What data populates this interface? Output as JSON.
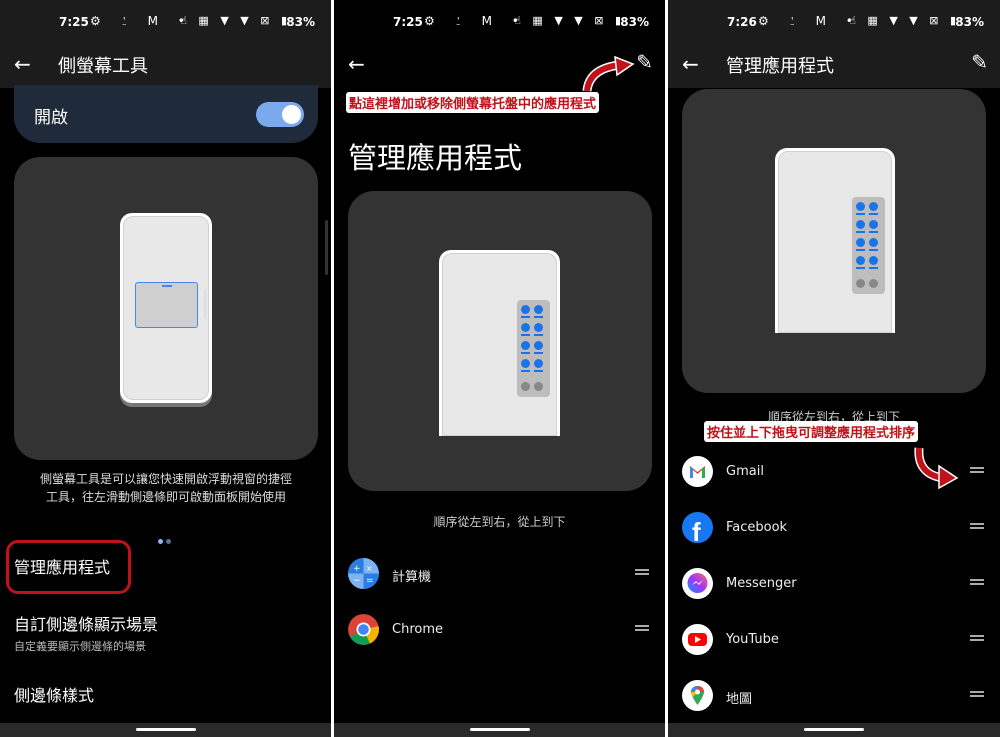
{
  "status_bars": [
    {
      "time": "7:25",
      "left_icons": "⚙ ⍘ M •",
      "right_icons": "☝ ▦ ▼ ▼ ⊠ ▮",
      "battery": "83%"
    },
    {
      "time": "7:25",
      "left_icons": "⚙ ⍘ M •",
      "right_icons": "☝ ▦ ▼ ▼ ⊠ ▮",
      "battery": "83%"
    },
    {
      "time": "7:26",
      "left_icons": "⚙ ⍘ M •",
      "right_icons": "☝ ▦ ▼ ▼ ⊠ ▮",
      "battery": "83%"
    }
  ],
  "icons": {
    "back": "←",
    "edit": "✎"
  },
  "panel1": {
    "title": "側螢幕工具",
    "toggle": {
      "label": "開啟",
      "on": true
    },
    "description": "側螢幕工具是可以讓您快速開啟浮動視窗的捷徑工具，往左滑動側邊條即可啟動面板開始使用",
    "pager": {
      "count": 2,
      "active": 1
    },
    "menu": [
      {
        "title": "管理應用程式",
        "subtitle": ""
      },
      {
        "title": "自訂側邊條顯示場景",
        "subtitle": "自定義要顯示側邊條的場景"
      },
      {
        "title": "側邊條樣式",
        "subtitle": ""
      }
    ]
  },
  "panel2": {
    "annotation": "點這裡增加或移除側螢幕托盤中的應用程式",
    "title": "管理應用程式",
    "caption": "順序從左到右，從上到下",
    "apps": [
      {
        "name": "計算機",
        "icon": "calculator-icon"
      },
      {
        "name": "Chrome",
        "icon": "chrome-icon"
      }
    ]
  },
  "panel3": {
    "title": "管理應用程式",
    "caption": "順序從左到右，從上到下",
    "annotation": "按住並上下拖曳可調整應用程式排序",
    "apps": [
      {
        "name": "Gmail",
        "icon": "gmail-icon"
      },
      {
        "name": "Facebook",
        "icon": "facebook-icon"
      },
      {
        "name": "Messenger",
        "icon": "messenger-icon"
      },
      {
        "name": "YouTube",
        "icon": "youtube-icon"
      },
      {
        "name": "地圖",
        "icon": "maps-icon"
      }
    ]
  },
  "colors": {
    "accent": "#7aa9ee",
    "annotation": "#c0121a",
    "tray_icon": "#1a73e8"
  }
}
